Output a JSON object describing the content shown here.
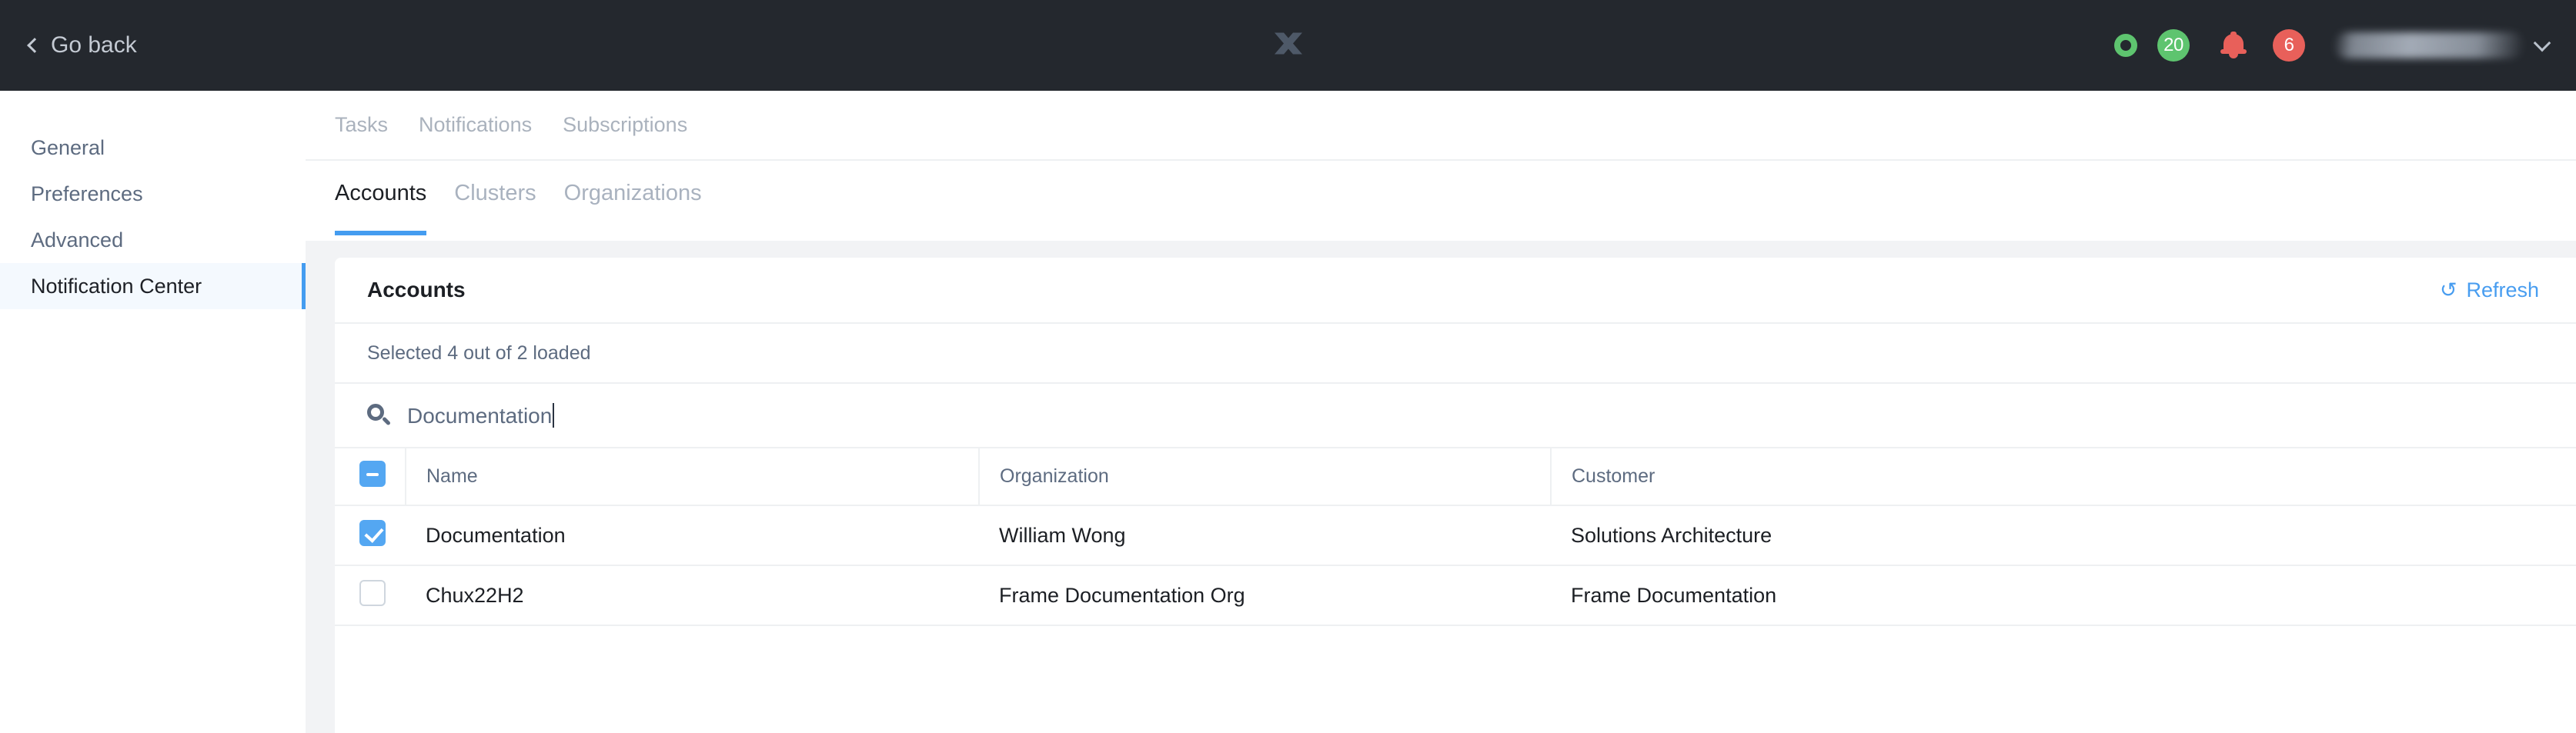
{
  "topbar": {
    "go_back_label": "Go back",
    "go_back_icon": "chevron-left-icon",
    "logo_icon": "x-logo-icon",
    "status_ring_icon": "status-ring-icon",
    "green_badge_count": "20",
    "bell_icon": "bell-icon",
    "red_badge_count": "6",
    "username": "",
    "user_menu_icon": "chevron-down-icon",
    "colors": {
      "bar_background": "#24282e",
      "green": "#5ec46f",
      "red": "#e8605a",
      "logo": "#4e5968"
    }
  },
  "sidebar": {
    "items": [
      {
        "label": "General",
        "active": false
      },
      {
        "label": "Preferences",
        "active": false
      },
      {
        "label": "Advanced",
        "active": false
      },
      {
        "label": "Notification Center",
        "active": true
      }
    ]
  },
  "top_tabs": [
    {
      "label": "Tasks",
      "active": false
    },
    {
      "label": "Notifications",
      "active": false
    },
    {
      "label": "Subscriptions",
      "active": false
    }
  ],
  "sub_tabs": [
    {
      "label": "Accounts",
      "active": true
    },
    {
      "label": "Clusters",
      "active": false
    },
    {
      "label": "Organizations",
      "active": false
    }
  ],
  "card": {
    "title": "Accounts",
    "refresh_label": "Refresh",
    "refresh_icon": "refresh-icon",
    "selection_summary": "Selected 4 out of 2 loaded",
    "search": {
      "icon": "search-icon",
      "value": "Documentation",
      "placeholder": "Search"
    },
    "table": {
      "columns": [
        "Name",
        "Organization",
        "Customer"
      ],
      "header_checkbox_state": "indeterminate",
      "rows": [
        {
          "checked": true,
          "name": "Documentation",
          "organization": "William Wong",
          "customer": "Solutions Architecture"
        },
        {
          "checked": false,
          "name": "Chux22H2",
          "organization": "Frame Documentation Org",
          "customer": "Frame Documentation"
        }
      ]
    }
  },
  "accent_colors": {
    "blue": "#449cf0",
    "checkbox_blue": "#54a7f2",
    "muted_text": "#5d6b80",
    "panel_background": "#f2f3f5"
  }
}
